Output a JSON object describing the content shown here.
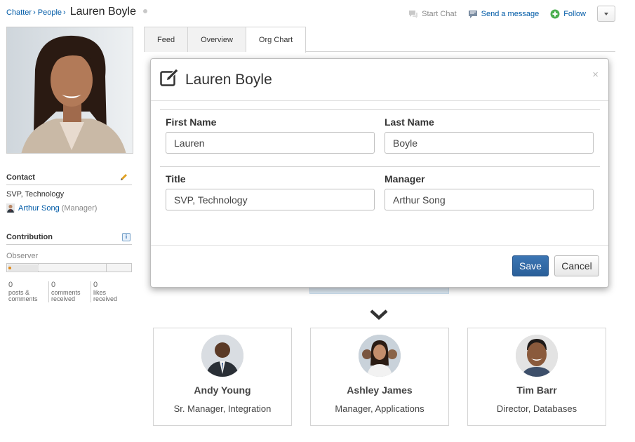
{
  "breadcrumb": {
    "items": [
      "Chatter",
      "People"
    ],
    "separator": "›",
    "current": "Lauren Boyle"
  },
  "header_actions": {
    "start_chat": "Start Chat",
    "send_message": "Send a message",
    "follow": "Follow"
  },
  "profile": {
    "contact_heading": "Contact",
    "job_title": "SVP, Technology",
    "manager_name": "Arthur Song",
    "manager_role": "(Manager)",
    "contribution_heading": "Contribution",
    "level": "Observer",
    "stats": [
      {
        "count": "0",
        "label_line1": "posts &",
        "label_line2": "comments"
      },
      {
        "count": "0",
        "label_line1": "comments",
        "label_line2": "received"
      },
      {
        "count": "0",
        "label_line1": "likes",
        "label_line2": "received"
      }
    ]
  },
  "tabs": [
    {
      "label": "Feed",
      "active": false
    },
    {
      "label": "Overview",
      "active": false
    },
    {
      "label": "Org Chart",
      "active": true
    }
  ],
  "modal": {
    "title": "Lauren Boyle",
    "close": "×",
    "fields": {
      "first_name": {
        "label": "First Name",
        "value": "Lauren"
      },
      "last_name": {
        "label": "Last Name",
        "value": "Boyle"
      },
      "title": {
        "label": "Title",
        "value": "SVP, Technology"
      },
      "manager": {
        "label": "Manager",
        "value": "Arthur Song"
      }
    },
    "save_label": "Save",
    "cancel_label": "Cancel"
  },
  "direct_reports": [
    {
      "name": "Andy Young",
      "title": "Sr. Manager, Integration"
    },
    {
      "name": "Ashley James",
      "title": "Manager, Applications"
    },
    {
      "name": "Tim Barr",
      "title": "Director, Databases"
    }
  ],
  "colors": {
    "link": "#015ba7",
    "primary_button": "#2f67a5",
    "follow_icon": "#4caf50"
  }
}
